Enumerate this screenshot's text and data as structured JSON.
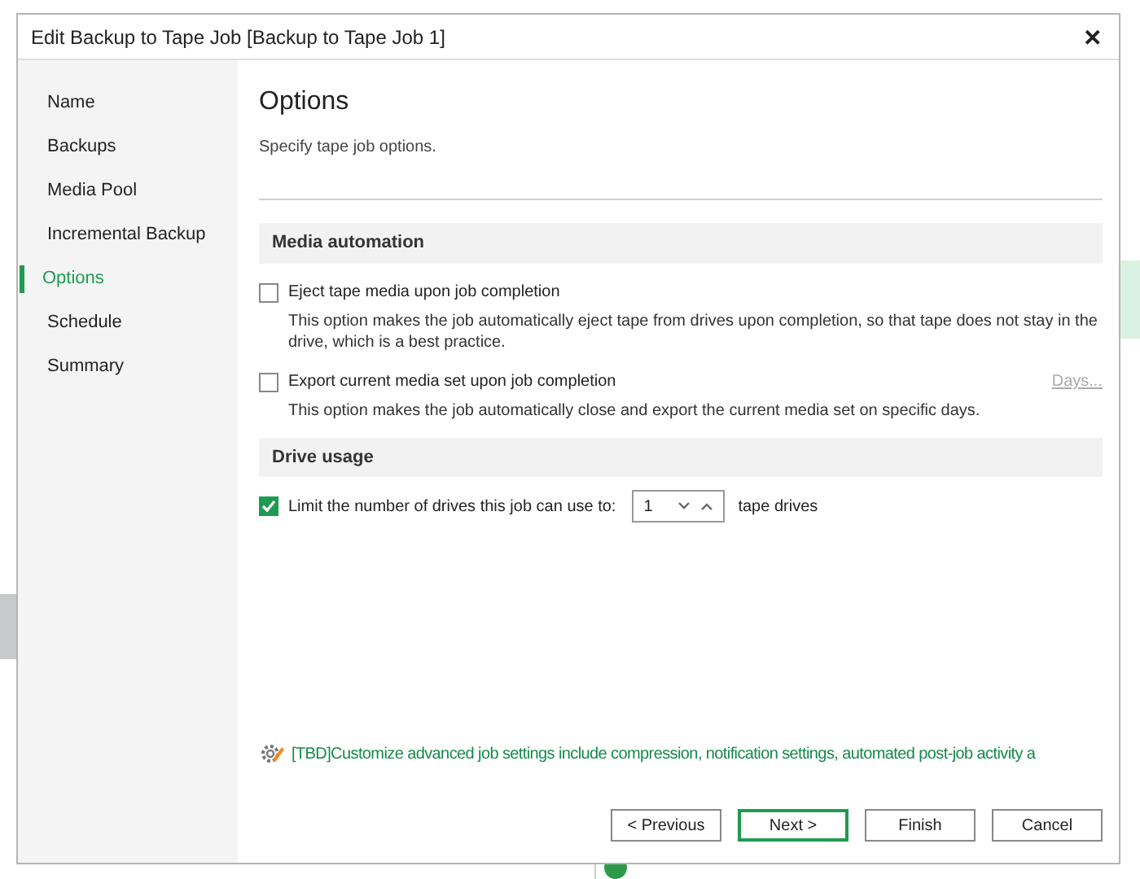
{
  "window": {
    "title": "Edit Backup to Tape Job [Backup to Tape Job 1]",
    "close": "✕"
  },
  "steps": [
    {
      "label": "Name",
      "selected": false
    },
    {
      "label": "Backups",
      "selected": false
    },
    {
      "label": "Media Pool",
      "selected": false
    },
    {
      "label": "Incremental Backup",
      "selected": false
    },
    {
      "label": "Options",
      "selected": true
    },
    {
      "label": "Schedule",
      "selected": false
    },
    {
      "label": "Summary",
      "selected": false
    }
  ],
  "page": {
    "title": "Options",
    "subtitle": "Specify tape job options."
  },
  "sections": [
    {
      "title": "Media automation",
      "options": [
        {
          "label": "Eject tape media upon job completion",
          "checked": false,
          "description": "This option makes the job automatically eject tape from drives upon completion, so that tape does not stay in the drive, which is a best practice."
        },
        {
          "label": "Export current media set upon job completion",
          "checked": false,
          "action": "Days...",
          "description": "This option makes the job automatically close and export the current media set on specific days."
        }
      ]
    },
    {
      "title": "Drive usage",
      "options": [
        {
          "label": "Limit the number of drives this job can use to:",
          "checked": true,
          "spinner": {
            "value": "1",
            "suffix": "tape drives"
          }
        }
      ]
    }
  ],
  "advanced_link": "[TBD]Customize advanced job settings include compression, notification settings, automated post-job activity a",
  "buttons": [
    {
      "label": "< Previous",
      "default": false
    },
    {
      "label": "Next >",
      "default": true
    },
    {
      "label": "Finish",
      "default": false
    },
    {
      "label": "Cancel",
      "default": false
    }
  ]
}
